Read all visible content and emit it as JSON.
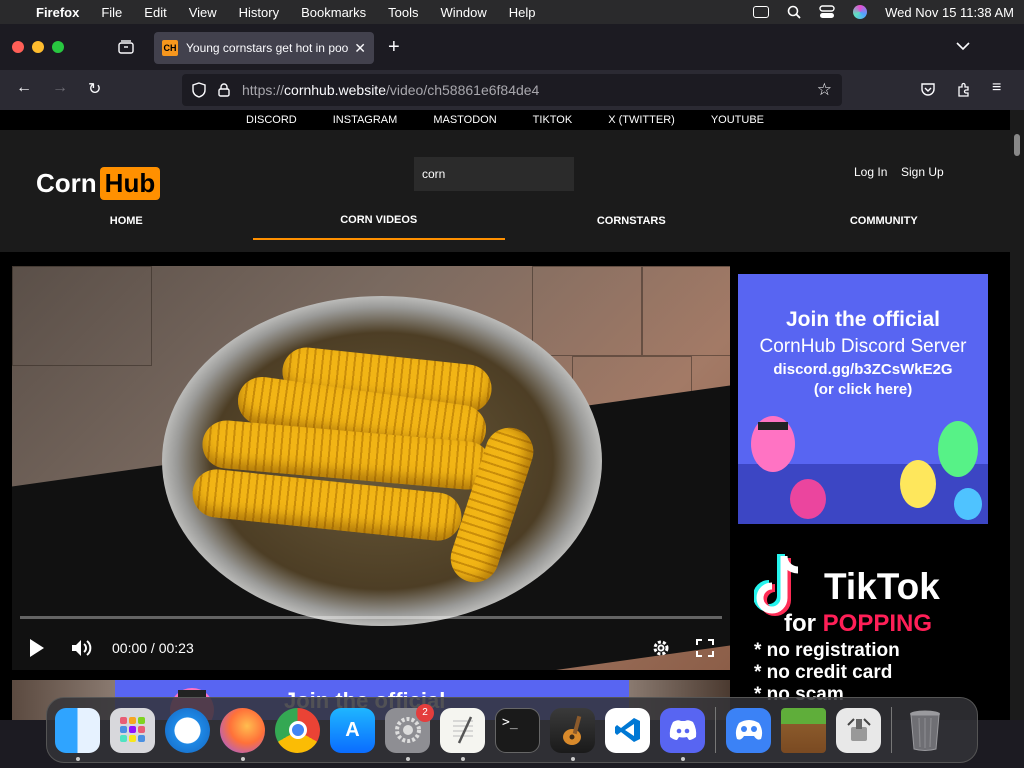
{
  "menubar": {
    "app": "Firefox",
    "items": [
      "File",
      "Edit",
      "View",
      "History",
      "Bookmarks",
      "Tools",
      "Window",
      "Help"
    ],
    "datetime": "Wed Nov 15  11:38 AM"
  },
  "tab": {
    "favicon_text": "CH",
    "title": "Young cornstars get hot in pool"
  },
  "urlbar": {
    "scheme": "https://",
    "host": "cornhub.website",
    "path": "/video/ch58861e6f84de4"
  },
  "social_links": [
    "DISCORD",
    "INSTAGRAM",
    "MASTODON",
    "TIKTOK",
    "X (TWITTER)",
    "YOUTUBE"
  ],
  "site": {
    "logo_corn": "Corn",
    "logo_hub": "Hub",
    "search_value": "corn",
    "login": "Log In",
    "signup": "Sign Up",
    "nav": [
      "HOME",
      "CORN VIDEOS",
      "CORNSTARS",
      "COMMUNITY"
    ]
  },
  "player": {
    "time": "00:00 / 00:23"
  },
  "ad_discord": {
    "line1": "Join the official",
    "line2": "CornHub Discord Server",
    "line3": "discord.gg/b3ZCsWkE2G",
    "line4": "(or click here)"
  },
  "ad_tiktok": {
    "brand": "TikTok",
    "for": "for",
    "popping": "POPPING",
    "lines": [
      "* no registration",
      "* no credit card",
      "* no scam"
    ]
  },
  "banner": {
    "text": "Join the official"
  },
  "dock": {
    "settings_badge": "2",
    "apps": [
      "finder-icon",
      "launchpad-icon",
      "safari-icon",
      "firefox-icon",
      "chrome-icon",
      "app-store-icon",
      "system-settings-icon",
      "textedit-icon",
      "terminal-icon",
      "garageband-icon",
      "vscode-icon",
      "discord-icon",
      "game-controller-icon",
      "minecraft-icon",
      "archive-utility-icon",
      "trash-icon"
    ]
  },
  "colors": {
    "accent": "#ff9000",
    "discord": "#5865f2",
    "tiktok_red": "#ff1f57"
  }
}
